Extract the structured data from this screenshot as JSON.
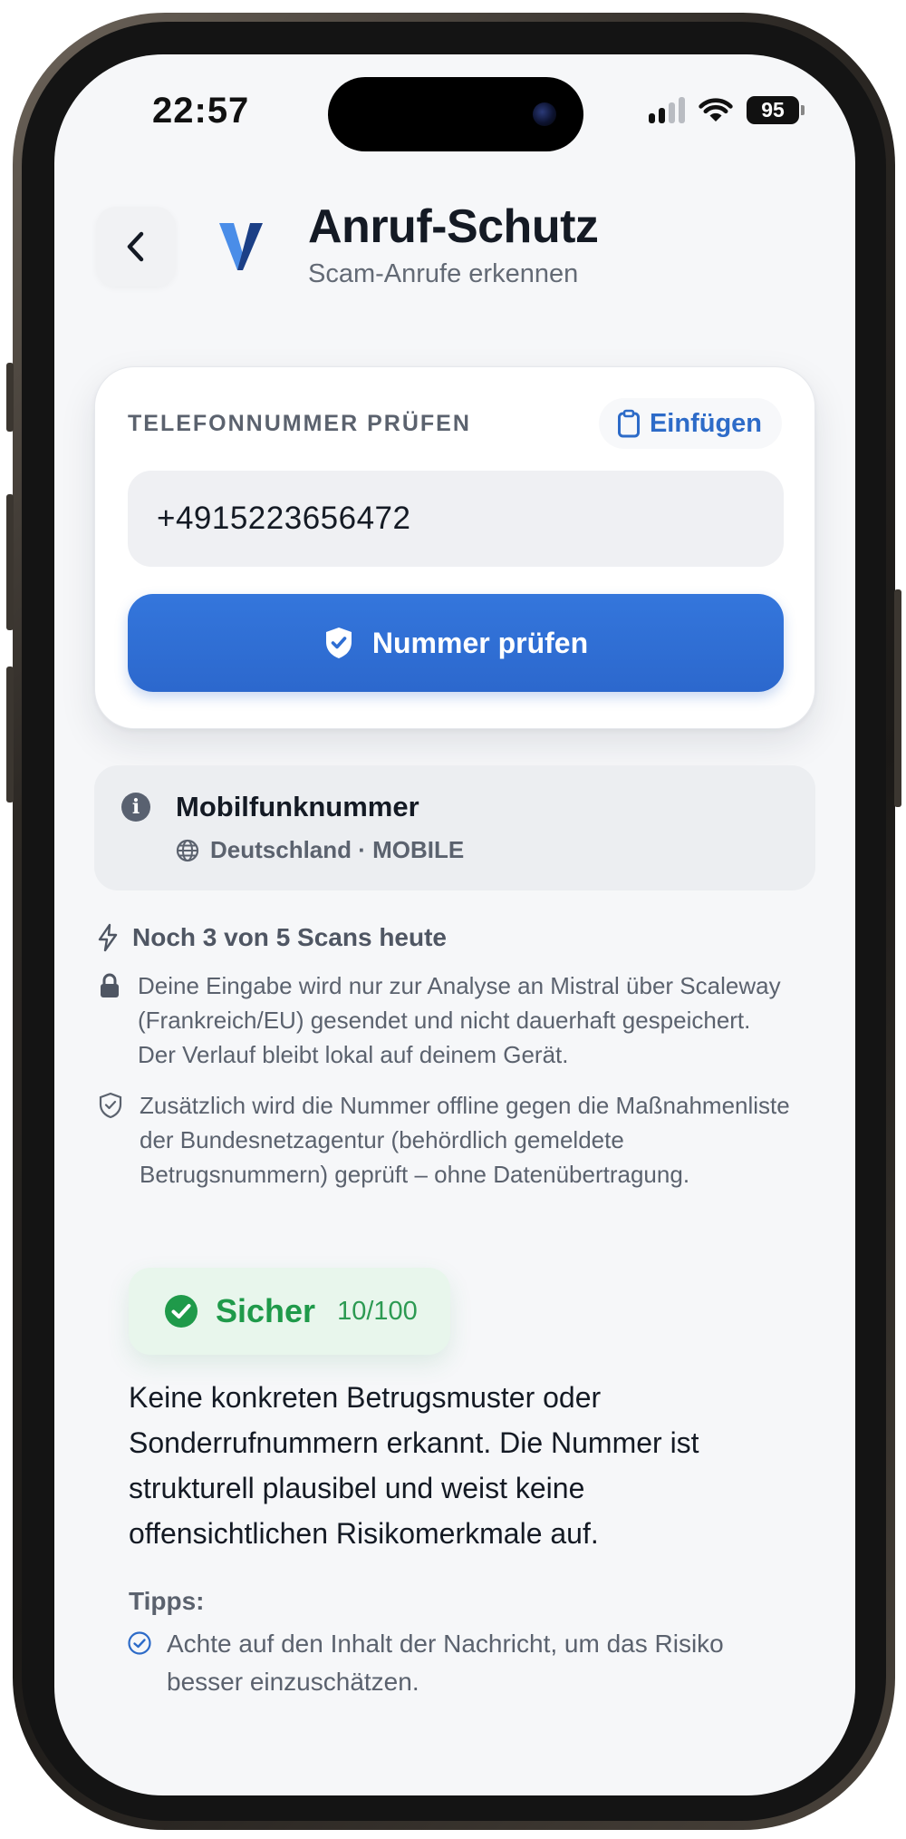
{
  "status_bar": {
    "time": "22:57",
    "battery": "95",
    "icons": [
      "cellular-signal-icon",
      "wifi-icon",
      "battery-icon"
    ]
  },
  "header": {
    "back_icon": "chevron-left-icon",
    "logo_icon": "v-logo-icon",
    "title": "Anruf-Schutz",
    "subtitle": "Scam-Anrufe erkennen"
  },
  "check_card": {
    "label": "TELEFONNUMMER PRÜFEN",
    "paste_label": "Einfügen",
    "paste_icon": "clipboard-icon",
    "input_value": "+4915223656472",
    "button_label": "Nummer prüfen",
    "button_icon": "shield-check-icon"
  },
  "number_info": {
    "title": "Mobilfunknummer",
    "detail": "Deutschland · MOBILE",
    "icons": [
      "info-icon",
      "globe-icon"
    ]
  },
  "notes": {
    "scans_left": "Noch 3 von 5 Scans heute",
    "privacy": "Deine Eingabe wird nur zur Analyse an Mistral über Scaleway (Frankreich/EU) gesendet und nicht dauerhaft gespeichert. Der Verlauf bleibt lokal auf deinem Gerät.",
    "offline_check": "Zusätzlich wird die Nummer offline gegen die Maßnahmenliste der Bundesnetzagentur (behördlich gemeldete Betrugsnummern) geprüft – ohne Datenübertragung.",
    "icons": [
      "lightning-icon",
      "lock-icon",
      "shield-outline-icon"
    ]
  },
  "result": {
    "verdict": "Sicher",
    "score": "10/100",
    "score_value": 10,
    "text": "Keine konkreten Betrugsmuster oder Sonderrufnummern erkannt. Die Nummer ist strukturell plausibel und weist keine offensichtlichen Risikomerkmale auf.",
    "tips_title": "Tipps:",
    "tips": [
      "Achte auf den Inhalt der Nachricht, um das Risiko besser einzuschätzen."
    ]
  },
  "colors": {
    "accent": "#2d6bc8",
    "safe": "#1f9a4a",
    "safe_bg": "#e8f6ec",
    "background": "#f6f7f9",
    "text": "#141a24",
    "muted": "#5b626e"
  }
}
